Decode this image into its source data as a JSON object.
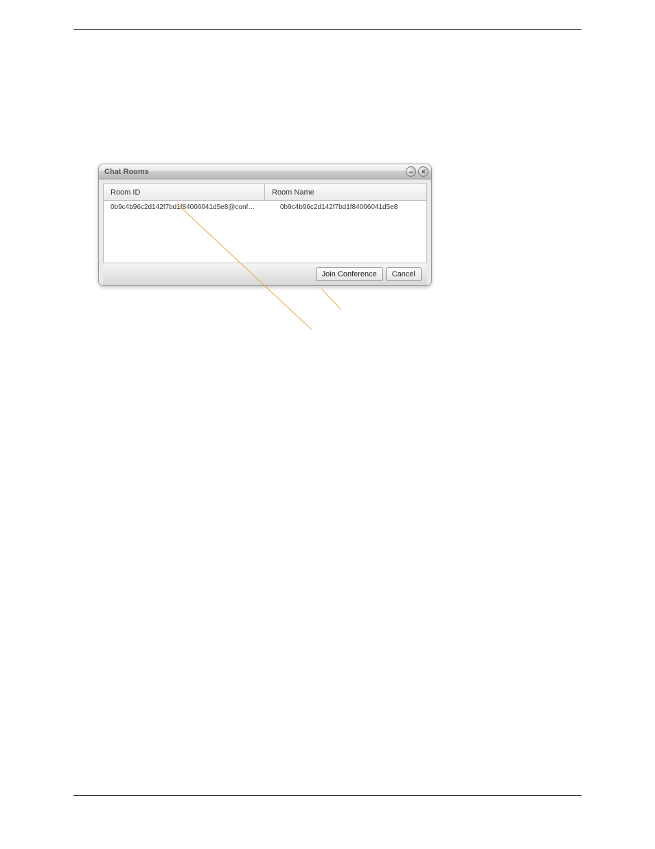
{
  "dialog": {
    "title": "Chat Rooms",
    "columns": {
      "id": "Room ID",
      "name": "Room Name"
    },
    "rows": [
      {
        "id": "0b9c4b96c2d142f7bd1f84006041d5e8@conf…",
        "name": "0b9c4b96c2d142f7bd1f84006041d5e8"
      }
    ],
    "buttons": {
      "join": "Join Conference",
      "cancel": "Cancel"
    }
  }
}
